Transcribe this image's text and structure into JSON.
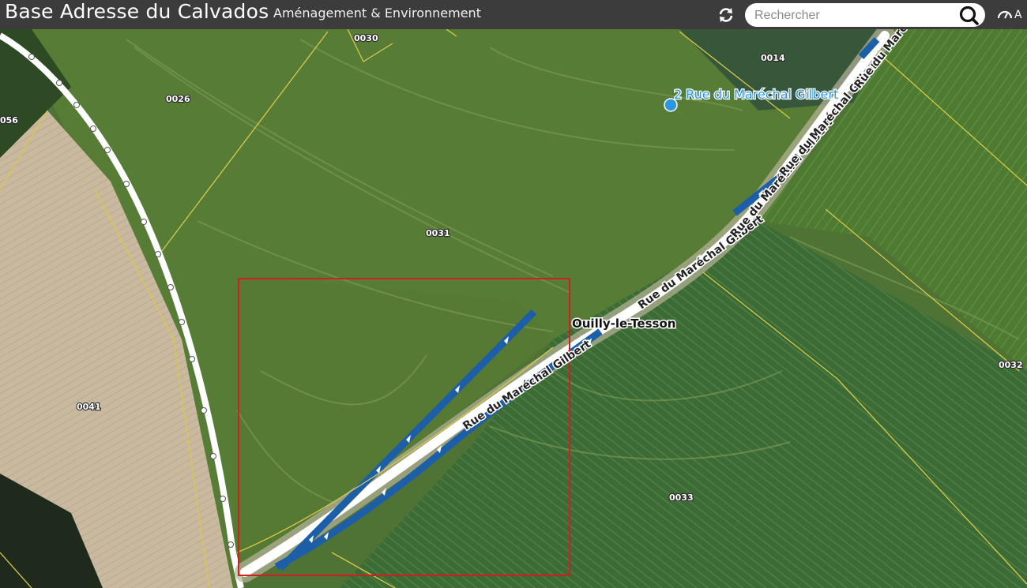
{
  "header": {
    "title": "Base Adresse du Calvados",
    "subtitle": "Aménagement & Environnement",
    "refresh_icon": "refresh-icon",
    "search": {
      "placeholder": "Rechercher",
      "icon": "search-icon"
    },
    "user_label": "A",
    "colors": {
      "bar": "#3c3c3c",
      "text": "#ffffff"
    }
  },
  "map": {
    "parcels": [
      {
        "id": "0030",
        "label": "0030"
      },
      {
        "id": "0014",
        "label": "0014"
      },
      {
        "id": "0026",
        "label": "0026"
      },
      {
        "id": "0056",
        "label": "056"
      },
      {
        "id": "0031",
        "label": "0031"
      },
      {
        "id": "0041",
        "label": "0041"
      },
      {
        "id": "0032",
        "label": "0032"
      },
      {
        "id": "0033",
        "label": "0033"
      }
    ],
    "roads": [
      {
        "name": "Rue du Maréchal Gilbert",
        "labels": [
          "Rue du Maréchal Gilbert",
          "Rue du Maréchal Gilbert",
          "Rue du Maréchal Gilbert",
          "Rue du Maréchal Gilbert",
          "Rue du Maréchal Gilbert"
        ]
      }
    ],
    "address_point": {
      "label": "2 Rue du Maréchal Gilbert",
      "color": "#2d96e0"
    },
    "place_name": "Ouilly-le-Tesson",
    "colors": {
      "parcel_line": "#d8c94a",
      "road_fill": "#1c5fa8",
      "selection_box": "#d11f1f"
    }
  }
}
